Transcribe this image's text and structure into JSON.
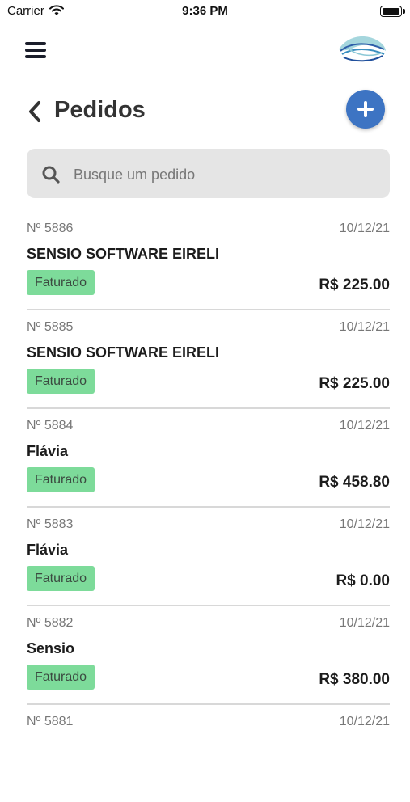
{
  "status_bar": {
    "carrier": "Carrier",
    "time": "9:36 PM"
  },
  "header": {
    "title": "Pedidos"
  },
  "search": {
    "placeholder": "Busque um pedido",
    "value": ""
  },
  "orders": [
    {
      "number": "Nº 5886",
      "date": "10/12/21",
      "customer": "SENSIO SOFTWARE EIRELI",
      "status": "Faturado",
      "total": "R$ 225.00"
    },
    {
      "number": "Nº 5885",
      "date": "10/12/21",
      "customer": "SENSIO SOFTWARE EIRELI",
      "status": "Faturado",
      "total": "R$ 225.00"
    },
    {
      "number": "Nº 5884",
      "date": "10/12/21",
      "customer": "Flávia",
      "status": "Faturado",
      "total": "R$ 458.80"
    },
    {
      "number": "Nº 5883",
      "date": "10/12/21",
      "customer": "Flávia",
      "status": "Faturado",
      "total": "R$ 0.00"
    },
    {
      "number": "Nº 5882",
      "date": "10/12/21",
      "customer": "Sensio",
      "status": "Faturado",
      "total": "R$ 380.00"
    },
    {
      "number": "Nº 5881",
      "date": "10/12/21"
    }
  ],
  "colors": {
    "accent": "#3d74c3",
    "status_badge": "#7ddb9a",
    "search_bg": "#e5e5e5"
  },
  "icons": {
    "menu": "hamburger-icon",
    "back": "chevron-left-icon",
    "add": "plus-icon",
    "search": "search-icon",
    "logo": "wave-logo"
  }
}
